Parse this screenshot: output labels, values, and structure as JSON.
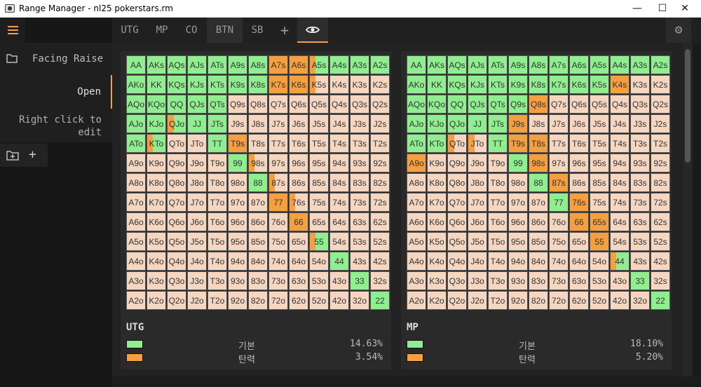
{
  "window": {
    "title": "Range Manager - nl25 pokerstars.rm",
    "minimize": "—",
    "maximize": "☐",
    "close": "✕"
  },
  "sidebar": {
    "facing_raise": "Facing Raise",
    "open": "Open",
    "hint": "Right click to edit",
    "folder_icon": "folder-icon",
    "new_folder_icon": "new-folder-icon",
    "add_label": "+"
  },
  "tabs": [
    {
      "label": "UTG"
    },
    {
      "label": "MP"
    },
    {
      "label": "CO"
    },
    {
      "label": "BTN"
    },
    {
      "label": "SB"
    }
  ],
  "add_tab_label": "+",
  "eye_icon": "eye-icon",
  "gear_icon": "gear-icon",
  "colors": {
    "basic": "#90ee90",
    "cell": "#f5d6c0",
    "resist": "#f5a040",
    "panel": "#2a2a2a"
  },
  "panels": [
    {
      "name": "UTG",
      "legend": [
        {
          "label": "기본",
          "pct": "14.63%",
          "color": "#90ee90"
        },
        {
          "label": "탄력",
          "pct": "3.54%",
          "color": "#f5a040"
        }
      ],
      "green": [
        "AA",
        "AKs",
        "AQs",
        "AJs",
        "ATs",
        "A9s",
        "A8s",
        "A7s",
        "A6s",
        "A5s",
        "A4s",
        "A3s",
        "A2s",
        "AKo",
        "KK",
        "KQs",
        "KJs",
        "KTs",
        "K9s",
        "K8s",
        "AQo",
        "KQo",
        "QQ",
        "QJs",
        "QTs",
        "AJo",
        "KJo",
        "QJo",
        "JJ",
        "JTs",
        "ATo",
        "KTo",
        "TT",
        "T9s",
        "99",
        "88",
        "77",
        "66",
        "55",
        "44",
        "33",
        "22"
      ],
      "orange": {
        "A7s": 1,
        "A6s": 1,
        "A5s": 0.3,
        "K7s": 1,
        "K6s": 1,
        "K5s": 0.3,
        "QJo": 0.35,
        "KTo": 0.3,
        "T9s": 1,
        "98s": 0.3,
        "87s": 0.3,
        "77": 1,
        "76s": 0.3,
        "66": 1,
        "55": 0.3
      }
    },
    {
      "name": "MP",
      "legend": [
        {
          "label": "기본",
          "pct": "18.10%",
          "color": "#90ee90"
        },
        {
          "label": "탄력",
          "pct": "5.20%",
          "color": "#f5a040"
        }
      ],
      "green": [
        "AA",
        "AKs",
        "AQs",
        "AJs",
        "ATs",
        "A9s",
        "A8s",
        "A7s",
        "A6s",
        "A5s",
        "A4s",
        "A3s",
        "A2s",
        "AKo",
        "KK",
        "KQs",
        "KJs",
        "KTs",
        "K9s",
        "K8s",
        "K7s",
        "K6s",
        "K5s",
        "AQo",
        "KQo",
        "QQ",
        "QJs",
        "QTs",
        "Q9s",
        "AJo",
        "KJo",
        "QJo",
        "JJ",
        "JTs",
        "J9s",
        "ATo",
        "KTo",
        "TT",
        "T9s",
        "T8s",
        "99",
        "98s",
        "88",
        "77",
        "66",
        "55",
        "44",
        "33",
        "22"
      ],
      "orange": {
        "K4s": 1,
        "Q8s": 1,
        "J9s": 1,
        "QTo": 0.35,
        "JTo": 0.35,
        "T9s": 1,
        "T8s": 1,
        "A9o": 1,
        "98s": 1,
        "87s": 1,
        "76s": 1,
        "66": 1,
        "65s": 1,
        "55": 1,
        "44": 0.3
      }
    }
  ]
}
